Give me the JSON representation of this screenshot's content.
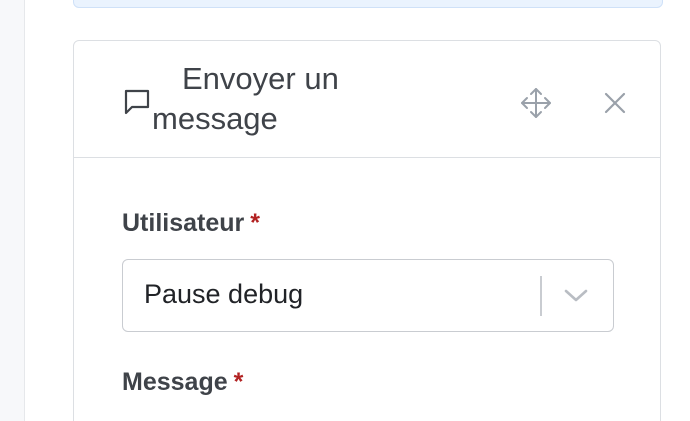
{
  "panel": {
    "title": "Envoyer un message",
    "icons": {
      "header": "chat-bubble-icon",
      "move": "move-icon",
      "close": "close-icon"
    }
  },
  "form": {
    "user_field": {
      "label": "Utilisateur",
      "required_mark": "*",
      "selected_value": "Pause debug"
    },
    "message_field": {
      "label": "Message",
      "required_mark": "*"
    }
  },
  "colors": {
    "text": "#3f4349",
    "required": "#b22222",
    "border": "#dcdfe3",
    "banner": "#eaf3fe",
    "icon": "#9aa1aa"
  }
}
